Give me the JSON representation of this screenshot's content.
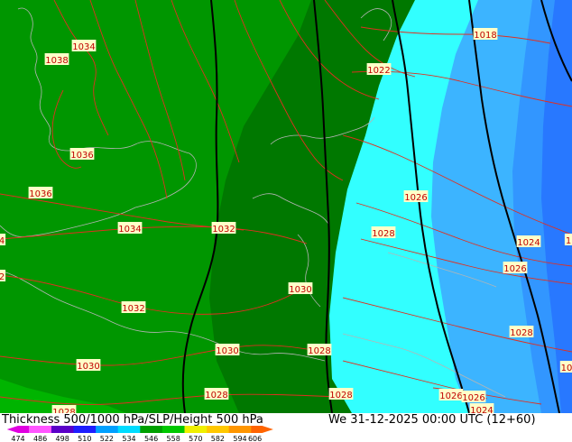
{
  "title": "Thickness 500/1000 hPa/SLP/Height 500 hPa",
  "valid_time": "We 31-12-2025 00:00 UTC (12+60)",
  "legend": {
    "ticks": [
      "474",
      "486",
      "498",
      "510",
      "522",
      "534",
      "546",
      "558",
      "570",
      "582",
      "594",
      "606"
    ],
    "colors": [
      "#e000e0",
      "#ff55ff",
      "#5a00c8",
      "#1e1eff",
      "#00a0ff",
      "#00dcff",
      "#00a000",
      "#00c800",
      "#f0f000",
      "#ffc800",
      "#ff9600",
      "#ff6400"
    ]
  },
  "fields": {
    "thickness_colors": {
      "green_light": "#009600",
      "green_mid": "#008c00",
      "green_dark": "#006e00",
      "cyan": "#32ffff",
      "blue_light": "#3cb4ff",
      "blue_mid": "#3296ff",
      "blue_dark": "#2878ff"
    },
    "isobar_color": "#e03020",
    "height_line_color": "#000000",
    "coast_color": "#b4b4b4"
  },
  "pressure_labels": [
    {
      "text": "1034"
    },
    {
      "text": "1038"
    },
    {
      "text": "1036"
    },
    {
      "text": "1036"
    },
    {
      "text": "1034"
    },
    {
      "text": "1032"
    },
    {
      "text": "1032"
    },
    {
      "text": "1030"
    },
    {
      "text": "1030"
    },
    {
      "text": "1030"
    },
    {
      "text": "1028"
    },
    {
      "text": "1028"
    },
    {
      "text": "1028"
    },
    {
      "text": "1026"
    },
    {
      "text": "1022"
    },
    {
      "text": "1018"
    },
    {
      "text": "1026"
    },
    {
      "text": "1028"
    },
    {
      "text": "1024"
    },
    {
      "text": "1026"
    },
    {
      "text": "1028"
    },
    {
      "text": "1028"
    },
    {
      "text": "1026"
    },
    {
      "text": "1024"
    },
    {
      "text": "4"
    },
    {
      "text": "2"
    },
    {
      "text": "1"
    },
    {
      "text": "10"
    }
  ]
}
